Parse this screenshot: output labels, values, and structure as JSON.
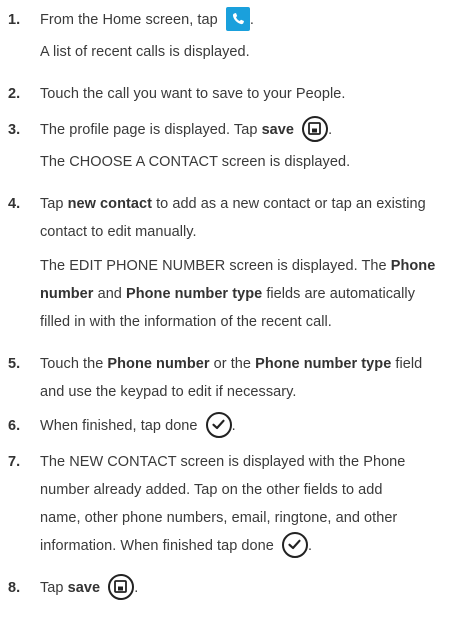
{
  "steps": [
    {
      "number": "1.",
      "text_before": "From the Home screen, tap",
      "icon": "phone-icon",
      "text_after": ".",
      "note": "A list of recent calls is displayed."
    },
    {
      "number": "2.",
      "text": "Touch the call you want to save to your People."
    },
    {
      "number": "3.",
      "text_before": "The profile page is displayed. Tap",
      "bold": "save",
      "icon": "save-icon",
      "text_after": ".",
      "note": "The CHOOSE A CONTACT screen is displayed."
    },
    {
      "number": "4.",
      "line1_before": "Tap",
      "line1_bold": "new contact",
      "line1_after": "to add as a new contact or tap an existing",
      "line2": "contact to edit manually.",
      "note1_before": "The EDIT PHONE NUMBER screen is displayed. The",
      "note1_bold": "Phone",
      "note2_bold1": "number",
      "note2_mid": "and",
      "note2_bold2": "Phone number type",
      "note2_after": "fields are automatically",
      "note3": "filled in with the information of the recent call."
    },
    {
      "number": "5.",
      "line1_before": "Touch the",
      "line1_bold1": "Phone number",
      "line1_mid": "or the",
      "line1_bold2": "Phone number type",
      "line1_after": "field",
      "line2": "and use the keypad to edit if necessary."
    },
    {
      "number": "6.",
      "text_before": "When finished, tap done",
      "icon": "checkmark-icon",
      "text_after": "."
    },
    {
      "number": "7.",
      "line1": "The NEW CONTACT screen is displayed with the Phone",
      "line2": "number already added. Tap on the other fields to add",
      "line3": "name, other phone numbers, email, ringtone, and other",
      "line4_before": "information. When finished tap done",
      "icon": "checkmark-icon",
      "line4_after": "."
    },
    {
      "number": "8.",
      "text_before": "Tap",
      "bold": "save",
      "icon": "save-icon",
      "text_after": "."
    }
  ],
  "colors": {
    "text": "#3a3a3a",
    "phone_icon_bg": "#1aa0dc",
    "icon_stroke": "#222222"
  }
}
